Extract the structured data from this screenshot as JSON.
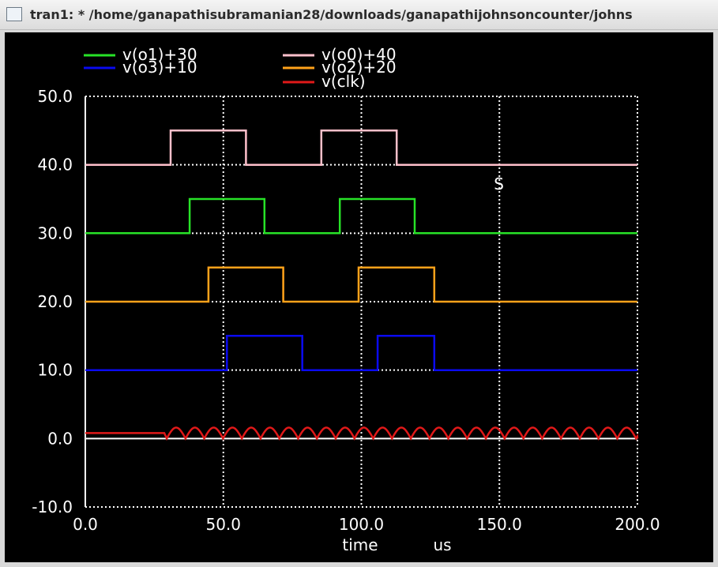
{
  "window": {
    "title": "tran1: * /home/ganapathisubramanian28/downloads/ganapathijohnsoncounter/johns",
    "icon": "window-icon"
  },
  "colors": {
    "background": "#000000",
    "axis": "#ffffff",
    "grid": "#ffffff",
    "o1": "#27e227",
    "o3": "#0a0af0",
    "o0": "#ffc0cb",
    "o2": "#ffa21a",
    "clk": "#e01919"
  },
  "chart_data": {
    "type": "line",
    "xlabel": "time",
    "xunit": "us",
    "xlim": [
      0,
      200
    ],
    "ylim": [
      -10,
      50
    ],
    "xticks": [
      0,
      50,
      100,
      150,
      200
    ],
    "xtick_labels": [
      "0.0",
      "50.0",
      "100.0",
      "150.0",
      "200.0"
    ],
    "yticks": [
      -10,
      0,
      10,
      20,
      30,
      40,
      50
    ],
    "ytick_labels": [
      "-10.0",
      "0.0",
      "10.0",
      "20.0",
      "30.0",
      "40.0",
      "50.0"
    ],
    "grid": true,
    "legend_position": "top",
    "annotation": "S",
    "annotation_at": [
      148,
      36.4
    ],
    "legend": [
      "v(o1)+30",
      "v(o3)+10",
      "v(o0)+40",
      "v(o2)+20",
      "v(clk)"
    ],
    "series": [
      {
        "name": "v(o1)+30",
        "color_key": "o1",
        "x": [
          0,
          37.8,
          37.8,
          64.9,
          64.9,
          92.2,
          92.2,
          119.3,
          119.3,
          200
        ],
        "y": [
          30,
          30,
          35,
          35,
          30,
          30,
          35,
          35,
          30,
          30
        ]
      },
      {
        "name": "v(o3)+10",
        "color_key": "o3",
        "x": [
          0,
          51.3,
          51.3,
          78.6,
          78.6,
          105.9,
          105.9,
          126.4,
          126.4,
          200
        ],
        "y": [
          10,
          10,
          15,
          15,
          10,
          10,
          15,
          15,
          10,
          10
        ]
      },
      {
        "name": "v(o0)+40",
        "color_key": "o0",
        "x": [
          0,
          30.9,
          30.9,
          58.2,
          58.2,
          85.5,
          85.5,
          112.8,
          112.8,
          200
        ],
        "y": [
          40,
          40,
          45,
          45,
          40,
          40,
          45,
          45,
          40,
          40
        ]
      },
      {
        "name": "v(o2)+20",
        "color_key": "o2",
        "x": [
          0,
          44.6,
          44.6,
          71.7,
          71.7,
          99.0,
          99.0,
          126.4,
          126.4,
          200
        ],
        "y": [
          20,
          20,
          25,
          25,
          20,
          20,
          25,
          25,
          20,
          20
        ]
      },
      {
        "name": "v(clk)",
        "color_key": "clk",
        "x": [
          0,
          28.6,
          29.5,
          200
        ],
        "y": [
          0.8,
          0.8,
          0,
          0
        ],
        "oscillation": {
          "start": 29.5,
          "end": 200,
          "period": 6.8,
          "min": 0,
          "max": 1.6
        }
      }
    ]
  }
}
